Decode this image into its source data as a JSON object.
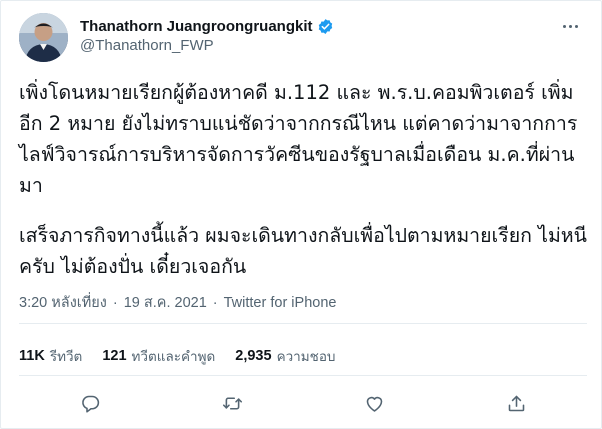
{
  "tweet": {
    "author": {
      "display_name": "Thanathorn Juangroongruangkit",
      "handle": "@Thanathorn_FWP",
      "verified": true
    },
    "text_paragraphs": [
      "เพิ่งโดนหมายเรียกผู้ต้องหาคดี ม.112 และ พ.ร.บ.คอมพิวเตอร์ เพิ่มอีก 2 หมาย ยังไม่ทราบแน่ชัดว่าจากกรณีไหน แต่คาดว่ามาจากการไลฟ์วิจารณ์การบริหารจัดการวัคซีนของรัฐบาลเมื่อเดือน ม.ค.ที่ผ่านมา",
      "เสร็จภารกิจทางนี้แล้ว ผมจะเดินทางกลับเพื่อไปตามหมายเรียก ไม่หนีครับ ไม่ต้องปั่น เดี๋ยวเจอกัน"
    ],
    "time": "3:20 หลังเที่ยง",
    "date": "19 ส.ค. 2021",
    "separator": "·",
    "source": "Twitter for iPhone",
    "stats": {
      "retweets_count": "11K",
      "retweets_label": "รีทวีต",
      "quotes_count": "121",
      "quotes_label": "ทวีตและคำพูด",
      "likes_count": "2,935",
      "likes_label": "ความชอบ"
    }
  },
  "icons": {
    "verified": "verified-badge-icon",
    "more": "more-options-icon",
    "reply": "reply-icon",
    "retweet": "retweet-icon",
    "like": "heart-icon",
    "share": "share-icon"
  },
  "colors": {
    "text_primary": "#0f1419",
    "text_secondary": "#536471",
    "verified_blue": "#1d9bf0",
    "divider": "#e6ecf0"
  }
}
